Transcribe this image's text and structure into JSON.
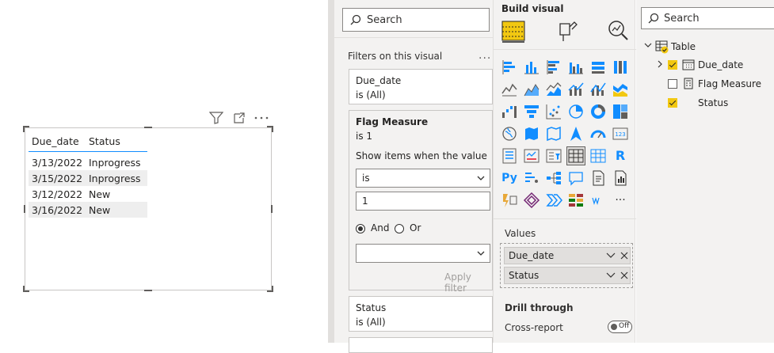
{
  "canvas": {
    "table": {
      "columns": [
        "Due_date",
        "Status"
      ],
      "rows": [
        {
          "due_date": "3/13/2022",
          "status": "Inprogress"
        },
        {
          "due_date": "3/15/2022",
          "status": "Inprogress"
        },
        {
          "due_date": "3/12/2022",
          "status": "New"
        },
        {
          "due_date": "3/16/2022",
          "status": "New"
        }
      ]
    },
    "header_icons": [
      "filter-icon",
      "focus-mode-icon",
      "more-options-icon"
    ]
  },
  "filters": {
    "search_placeholder": "Search",
    "section_title": "Filters on this visual",
    "more": "...",
    "cards": [
      {
        "field": "Due_date",
        "summary": "is (All)"
      },
      {
        "field": "Flag Measure",
        "summary": "is 1",
        "show_items_label": "Show items when the value",
        "operator": "is",
        "value": "1",
        "and_label": "And",
        "or_label": "Or",
        "selected_logic": "And",
        "apply_label": "Apply filter"
      },
      {
        "field": "Status",
        "summary": "is (All)"
      }
    ]
  },
  "build": {
    "title": "Build visual",
    "tabs": [
      "fields-tab-icon",
      "format-tab-icon",
      "analytics-tab-icon"
    ],
    "r_label": "R",
    "py_label": "Py",
    "wells": {
      "label": "Values",
      "fields": [
        "Due_date",
        "Status"
      ]
    },
    "drill_through": "Drill through",
    "cross_report": "Cross-report",
    "toggle_state": "Off",
    "more": "..."
  },
  "data": {
    "search_placeholder": "Search",
    "table_name": "Table",
    "fields": [
      {
        "name": "Due_date",
        "checked": true,
        "type": "date-hierarchy"
      },
      {
        "name": "Flag Measure",
        "checked": false,
        "type": "measure"
      },
      {
        "name": "Status",
        "checked": true,
        "type": "text"
      }
    ]
  },
  "colors": {
    "accent_blue": "#118dff",
    "checkbox_yellow": "#f2c811",
    "pane_bg": "#f3f2f1"
  }
}
